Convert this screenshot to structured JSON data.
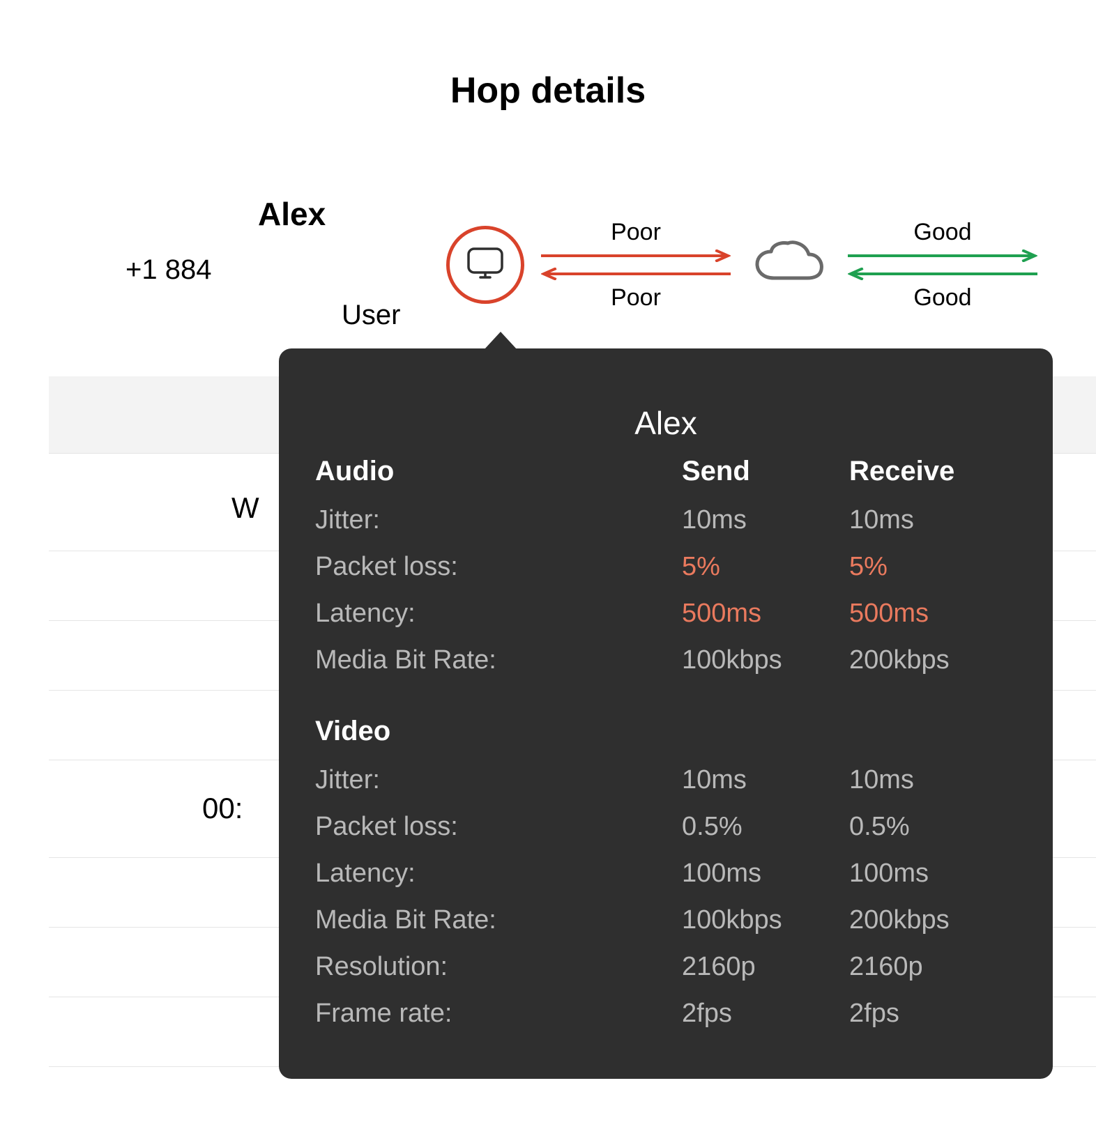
{
  "page_title": "Hop details",
  "user": {
    "name": "Alex",
    "phone": "+1 884",
    "label": "User"
  },
  "background_fragments": {
    "letter": "W",
    "time": "00:"
  },
  "hops": {
    "hop1": {
      "top_label": "Poor",
      "bottom_label": "Poor",
      "status": "poor"
    },
    "hop2": {
      "top_label": "Good",
      "bottom_label": "Good",
      "status": "good"
    }
  },
  "tooltip": {
    "name": "Alex",
    "columns": {
      "send": "Send",
      "receive": "Receive"
    },
    "sections": [
      {
        "title": "Audio",
        "rows": [
          {
            "label": "Jitter:",
            "send": "10ms",
            "receive": "10ms",
            "warn": false
          },
          {
            "label": "Packet loss:",
            "send": "5%",
            "receive": "5%",
            "warn": true
          },
          {
            "label": "Latency:",
            "send": "500ms",
            "receive": "500ms",
            "warn": true
          },
          {
            "label": "Media Bit Rate:",
            "send": "100kbps",
            "receive": "200kbps",
            "warn": false
          }
        ]
      },
      {
        "title": "Video",
        "rows": [
          {
            "label": "Jitter:",
            "send": "10ms",
            "receive": "10ms",
            "warn": false
          },
          {
            "label": "Packet loss:",
            "send": "0.5%",
            "receive": "0.5%",
            "warn": false
          },
          {
            "label": "Latency:",
            "send": "100ms",
            "receive": "100ms",
            "warn": false
          },
          {
            "label": "Media Bit Rate:",
            "send": "100kbps",
            "receive": "200kbps",
            "warn": false
          },
          {
            "label": "Resolution:",
            "send": "2160p",
            "receive": "2160p",
            "warn": false
          },
          {
            "label": "Frame rate:",
            "send": "2fps",
            "receive": "2fps",
            "warn": false
          }
        ]
      }
    ]
  }
}
